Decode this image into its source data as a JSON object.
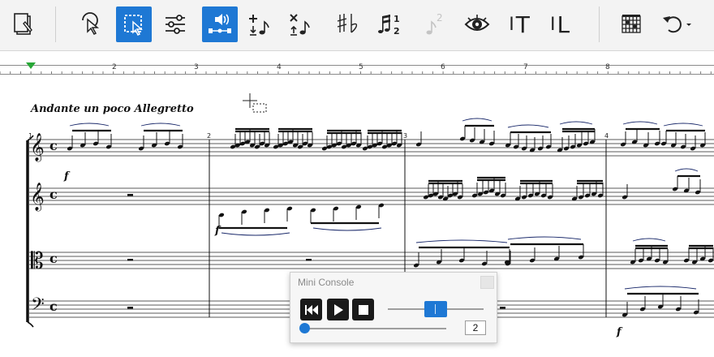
{
  "toolbar": {
    "buttons": [
      {
        "icon": "score-document-icon",
        "active": false
      },
      {
        "icon": "selection-cursor-icon",
        "active": false
      },
      {
        "icon": "rectangle-select-icon",
        "active": true
      },
      {
        "icon": "mixer-sliders-icon",
        "active": false
      },
      {
        "icon": "speaker-playback-icon",
        "active": true
      },
      {
        "icon": "add-note-above-icon",
        "active": false
      },
      {
        "icon": "delete-note-icon",
        "active": false
      },
      {
        "icon": "sharp-flat-icon",
        "active": false
      },
      {
        "icon": "tuplet-icon",
        "active": false
      },
      {
        "icon": "voice-2-icon",
        "active": false
      },
      {
        "icon": "eye-icon",
        "active": false
      },
      {
        "icon": "text-tool-icon",
        "active": false
      },
      {
        "icon": "lyrics-tool-icon",
        "active": false
      },
      {
        "icon": "chord-grid-icon",
        "active": false
      },
      {
        "icon": "undo-icon",
        "active": false
      }
    ],
    "text_tool_label": "T",
    "lyrics_tool_label": "L",
    "tuplet_label_top": "1",
    "tuplet_label_bottom": "2",
    "voice_label": "2",
    "accent": "#1e78d4"
  },
  "ruler": {
    "numbers": [
      "2",
      "3",
      "4",
      "5",
      "6",
      "7",
      "8"
    ]
  },
  "score": {
    "tempo": "Andante un poco Allegretto",
    "measure_numbers": [
      "1",
      "2",
      "3",
      "4"
    ],
    "time_signature": "c",
    "dynamics": [
      "f",
      "f",
      "f"
    ],
    "staves": [
      "treble",
      "treble",
      "alto",
      "bass"
    ]
  },
  "console": {
    "title": "Mini Console",
    "tempo_value": "2",
    "volume_level": 0.5,
    "tempo_level": 0.0
  }
}
